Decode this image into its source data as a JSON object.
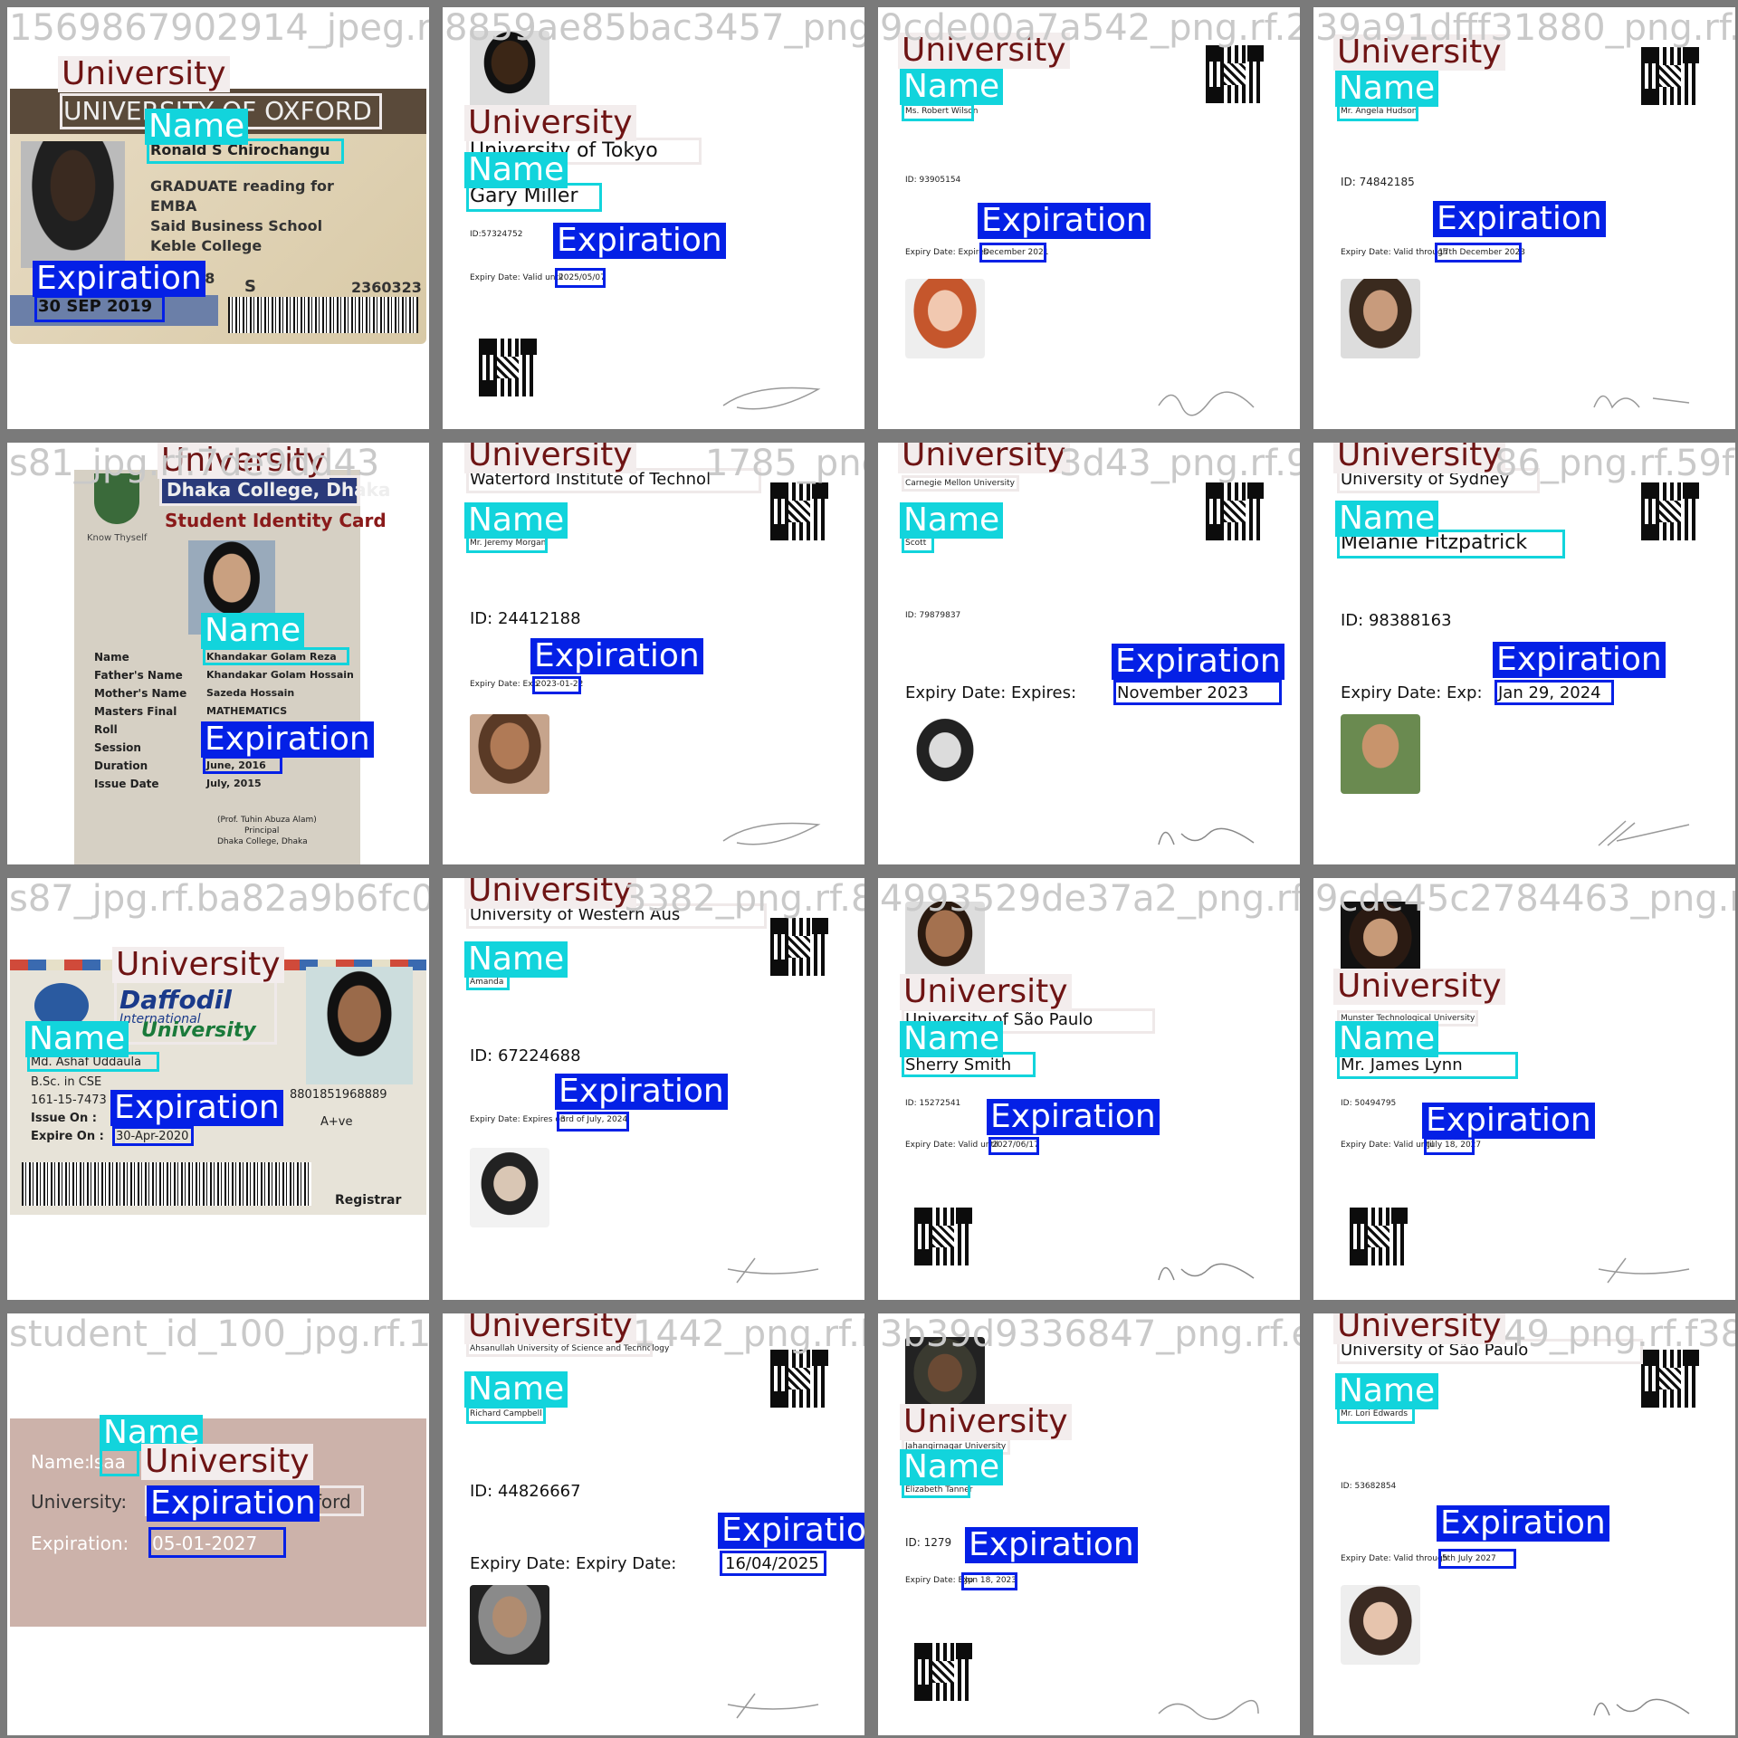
{
  "labels": {
    "university": "University",
    "name": "Name",
    "expiration": "Expiration"
  },
  "colors": {
    "university_box": "#efe9e9",
    "name_box": "#12d4dc",
    "expiration_box": "#0420e6",
    "grid_bg": "#7a7a7a"
  },
  "cells": [
    {
      "file": "1569867902914_jpeg.rf.d75",
      "card_texts": [
        "UNIVERSITY OF OXFORD",
        "Ronald S Chirochangu",
        "GRADUATE reading for",
        "EMBA",
        "Said Business School",
        "Keble College",
        "208",
        "S",
        "2360323",
        "30 SEP 2019"
      ]
    },
    {
      "file": "8859ae85bac3457_png.rf.ad21",
      "card_texts": [
        "University of Tokyo",
        "Gary Miller",
        "ID:57324752",
        "Expiry Date: Valid until",
        "2025/05/07"
      ]
    },
    {
      "file": "9cde00a7a542_png.rf.229b",
      "card_texts": [
        "Ms. Robert Wilson",
        "ID: 93905154",
        "Expiry Date: Expires",
        "December 2021"
      ]
    },
    {
      "file": "39a91dfff31880_png.rf.1b25",
      "card_texts": [
        "Mr. Angela Hudson",
        "ID: 74842185",
        "Expiry Date: Valid through",
        "17th December 2023"
      ]
    },
    {
      "file": "s81_jpg.rf.7de9dd43",
      "card_texts": [
        "Dhaka College, Dhaka",
        "Student Identity Card",
        "Know Thyself",
        "Name",
        "Father's Name",
        "Mother's Name",
        "Masters Final",
        "Roll",
        "Session",
        "Duration",
        "Issue Date",
        "Khandakar Golam Reza",
        "Khandakar Golam Hossain",
        "Sazeda Hossain",
        "MATHEMATICS",
        "June, 2016",
        "July, 2015",
        "(Prof. Tuhin Abuza Alam)",
        "Principal",
        "Dhaka College, Dhaka"
      ]
    },
    {
      "file": "1785_png.rf.08f9a",
      "card_texts": [
        "Waterford Institute of Technol",
        "Mr. Jeremy Morgan",
        "ID: 24412188",
        "Expiry Date: Exp",
        "2023-01-22"
      ]
    },
    {
      "file": "3d43_png.rf.90c8",
      "card_texts": [
        "Carnegie Mellon University",
        "Scott",
        "ID: 79879837",
        "Expiry Date: Expires:",
        "November 2023"
      ]
    },
    {
      "file": "86_png.rf.59f0003",
      "card_texts": [
        "University of Sydney",
        "Melanie Fitzpatrick",
        "ID: 98388163",
        "Expiry Date: Exp:",
        "Jan 29, 2024"
      ]
    },
    {
      "file": "s87_jpg.rf.ba82a9b6fc03ab9",
      "card_texts": [
        "Daffodil",
        "International",
        "University",
        "Md. Ashaf Uddaula",
        "B.Sc. in CSE",
        "161-15-7473",
        "Issue On :",
        "Expire On :",
        "30-Apr-2020",
        "8801851968889",
        "A+ve",
        "Registrar"
      ]
    },
    {
      "file": "3382_png.rf.84e9",
      "card_texts": [
        "University of Western Aus",
        "Amanda",
        "ID: 67224688",
        "Expiry Date: Expires on",
        "3rd of July, 2024"
      ]
    },
    {
      "file": "4993529de37a2_png.rf.927e9",
      "card_texts": [
        "University of São Paulo",
        "Sherry Smith",
        "ID: 15272541",
        "Expiry Date: Valid until",
        "2027/06/17"
      ]
    },
    {
      "file": "9cde45c2784463_png.rf.0ab9d",
      "card_texts": [
        "Munster Technological University",
        "Mr. James Lynn",
        "ID: 50494795",
        "Expiry Date: Valid until",
        "July 18, 2027"
      ]
    },
    {
      "file": "student_id_100_jpg.rf.19baa",
      "card_texts": [
        "Name:",
        "Isaa",
        "University:",
        "xford",
        "Expiration:",
        "05-01-2027"
      ]
    },
    {
      "file": "1442_png.rf.bb1e",
      "card_texts": [
        "Ahsanullah University of Science and Technology",
        "Richard Campbell",
        "ID: 44826667",
        "Expiry Date: Expiry Date:",
        "16/04/2025"
      ]
    },
    {
      "file": "3b39d9336847_png.rf.e9fff",
      "card_texts": [
        "Jahangirnagar University",
        "Elizabeth Tanner",
        "ID: 1279",
        "Expiry Date: Exp",
        "Jun 18, 2023"
      ]
    },
    {
      "file": "49_png.rf.f38214",
      "card_texts": [
        "University of São Paulo",
        "Mr. Lori Edwards",
        "ID: 53682854",
        "Expiry Date: Valid through",
        "5th July 2027"
      ]
    }
  ]
}
